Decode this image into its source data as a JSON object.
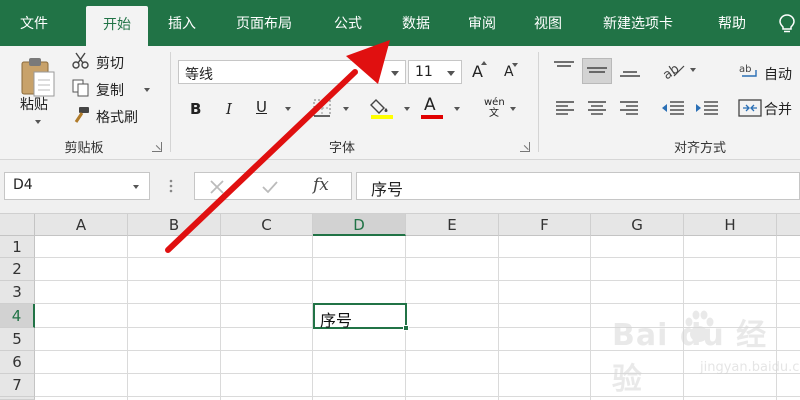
{
  "tabs": [
    {
      "label": "文件"
    },
    {
      "label": "开始",
      "active": true
    },
    {
      "label": "插入"
    },
    {
      "label": "页面布局"
    },
    {
      "label": "公式"
    },
    {
      "label": "数据"
    },
    {
      "label": "审阅"
    },
    {
      "label": "视图"
    },
    {
      "label": "新建选项卡"
    },
    {
      "label": "帮助"
    }
  ],
  "tab_tip_icon": "lightbulb-icon",
  "clipboard": {
    "paste_label": "粘贴",
    "cut_label": "剪切",
    "copy_label": "复制",
    "format_painter_label": "格式刷",
    "group_label": "剪贴板"
  },
  "font": {
    "font_name": "等线",
    "font_size": "11",
    "group_label": "字体",
    "bold_label": "B",
    "italic_label": "I",
    "underline_label": "U",
    "font_color_label": "A",
    "grow_label": "A",
    "shrink_label": "A",
    "pinyin_label": "wén文",
    "fill_color": "#ffff00",
    "font_color": "#e00000"
  },
  "alignment": {
    "group_label": "对齐方式",
    "wrap_label": "自动",
    "merge_label": "合并"
  },
  "formula_bar": {
    "name_box": "D4",
    "fx_label": "fx",
    "content": "序号"
  },
  "columns": [
    "A",
    "B",
    "C",
    "D",
    "E",
    "F",
    "G",
    "H"
  ],
  "rows": [
    "1",
    "2",
    "3",
    "4",
    "5",
    "6",
    "7"
  ],
  "selected_column": "D",
  "selected_row": "4",
  "active_cell": {
    "ref": "D4",
    "value": "序号"
  },
  "watermark": {
    "main": "Bai du 经验",
    "sub": "jingyan.baidu.com"
  },
  "colors": {
    "accent": "#217346",
    "arrow": "#e01010"
  }
}
